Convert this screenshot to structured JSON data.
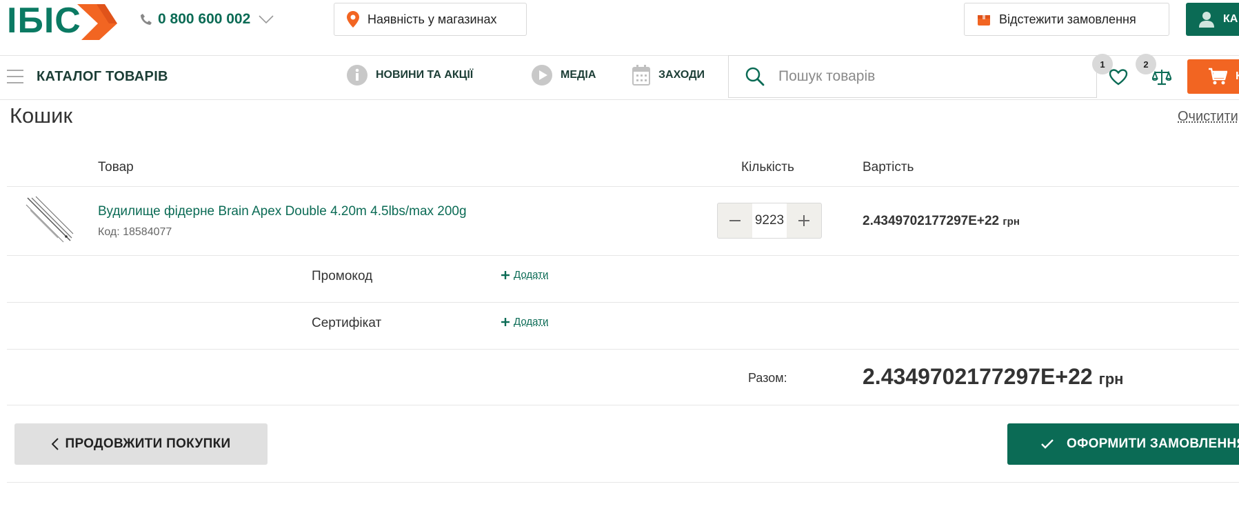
{
  "header": {
    "logo_text": "ІБІС",
    "phone": "0 800 600 002",
    "store_availability": "Наявність у магазинах",
    "track_order": "Відстежити замовлення",
    "account_label": "КА"
  },
  "nav": {
    "catalog": "КАТАЛОГ ТОВАРІВ",
    "items": [
      {
        "label": "НОВИНИ ТА АКЦІЇ",
        "icon": "info-icon"
      },
      {
        "label": "МЕДІА",
        "icon": "play-icon"
      },
      {
        "label": "ЗАХОДИ",
        "icon": "calendar-icon"
      }
    ],
    "search_placeholder": "Пошук товарів",
    "wishlist_count": "1",
    "compare_count": "2",
    "cart_label": "К"
  },
  "cart": {
    "title": "Кошик",
    "clear": "Очистити",
    "columns": {
      "product": "Товар",
      "quantity": "Кількість",
      "cost": "Вартість"
    },
    "item": {
      "name": "Вудилище фідерне Brain Apex Double 4.20m 4.5lbs/max 200g",
      "code": "Код: 18584077",
      "quantity": "9223",
      "price": "2.4349702177297E+22",
      "currency": "грн"
    },
    "promo": {
      "label": "Промокод",
      "add": "Додати"
    },
    "certificate": {
      "label": "Сертифікат",
      "add": "Додати"
    },
    "total": {
      "label": "Разом:",
      "value": "2.4349702177297E+22",
      "currency": "грн"
    },
    "continue_button": "ПРОДОВЖИТИ ПОКУПКИ",
    "checkout_button": "ОФОРМИТИ ЗАМОВЛЕННЯ"
  },
  "colors": {
    "brand_green": "#0b6b55",
    "brand_orange": "#f26522"
  }
}
